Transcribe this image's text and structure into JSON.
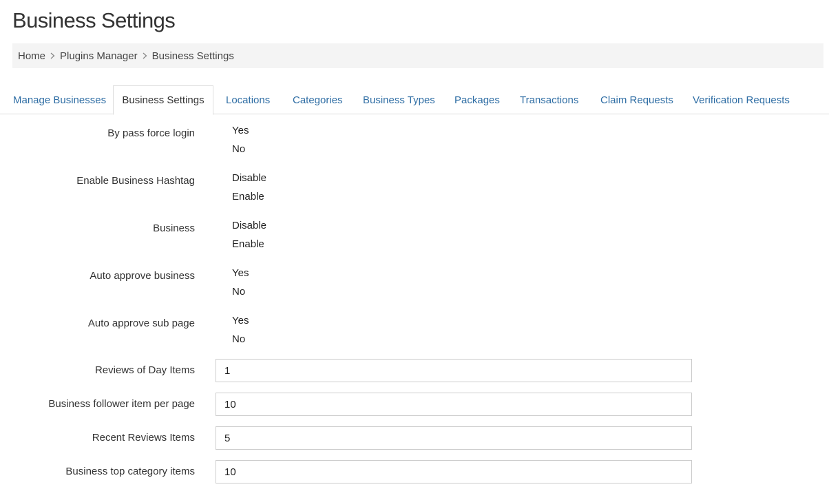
{
  "page": {
    "title": "Business Settings"
  },
  "breadcrumb": {
    "items": [
      "Home",
      "Plugins Manager",
      "Business Settings"
    ]
  },
  "tabs": [
    {
      "label": "Manage Businesses"
    },
    {
      "label": "Business Settings",
      "active": true
    },
    {
      "label": "Locations"
    },
    {
      "label": "Categories"
    },
    {
      "label": "Business Types"
    },
    {
      "label": "Packages"
    },
    {
      "label": "Transactions"
    },
    {
      "label": "Claim Requests"
    },
    {
      "label": "Verification Requests"
    }
  ],
  "settings": {
    "bypass_force_login": {
      "label": "By pass force login",
      "options": [
        "Yes",
        "No"
      ]
    },
    "enable_hashtag": {
      "label": "Enable Business Hashtag",
      "options": [
        "Disable",
        "Enable"
      ]
    },
    "business": {
      "label": "Business",
      "options": [
        "Disable",
        "Enable"
      ]
    },
    "auto_approve_business": {
      "label": "Auto approve business",
      "options": [
        "Yes",
        "No"
      ]
    },
    "auto_approve_sub_page": {
      "label": "Auto approve sub page",
      "options": [
        "Yes",
        "No"
      ]
    },
    "reviews_of_day": {
      "label": "Reviews of Day Items",
      "value": "1"
    },
    "follower_per_page": {
      "label": "Business follower item per page",
      "value": "10"
    },
    "recent_reviews": {
      "label": "Recent Reviews Items",
      "value": "5"
    },
    "top_category_items": {
      "label": "Business top category items",
      "value": "10"
    }
  },
  "colors": {
    "link": "#2e6da4",
    "breadcrumb_bg": "#f4f4f4",
    "border": "#dddddd"
  },
  "icons": {
    "breadcrumb_separator": "chevron-right-icon"
  }
}
